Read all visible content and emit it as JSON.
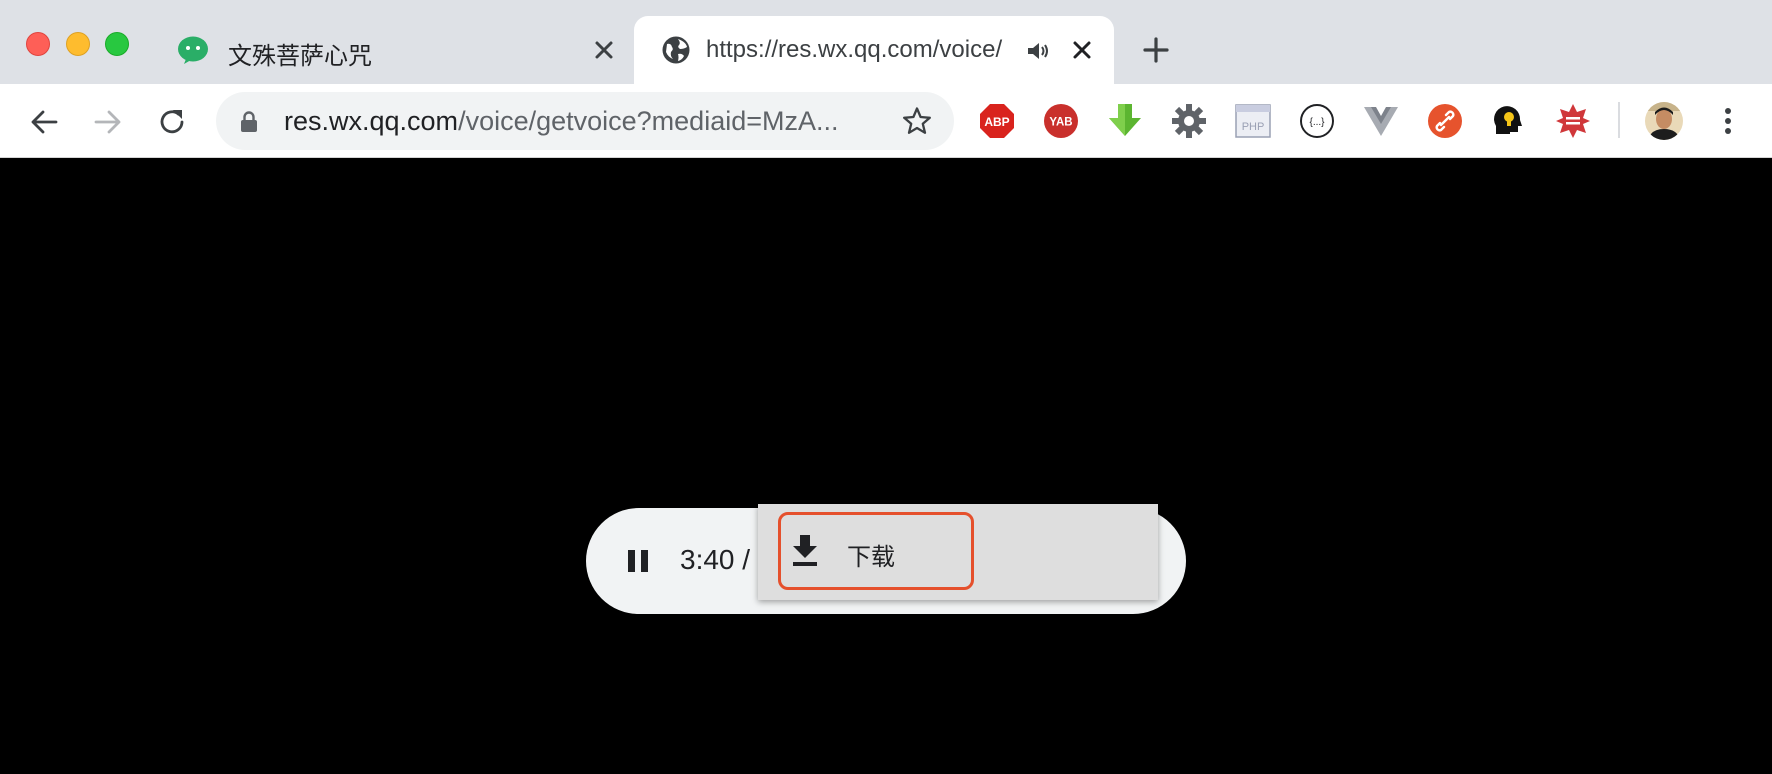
{
  "window": {
    "traffic_lights": [
      "close",
      "minimize",
      "maximize"
    ]
  },
  "tabs": [
    {
      "title": "文殊菩萨心咒",
      "icon": "wechat-icon",
      "active": false
    },
    {
      "title": "https://res.wx.qq.com/voice/",
      "icon": "globe-icon",
      "active": true,
      "audio_icon": "speaker-icon"
    }
  ],
  "toolbar": {
    "url_host": "res.wx.qq.com",
    "url_path": "/voice/getvoice?mediaid=MzA...",
    "extensions": [
      {
        "name": "abp-extension-icon",
        "label": "ABP",
        "color": "#d9231d"
      },
      {
        "name": "yab-extension-icon",
        "label": "YAB",
        "color": "#c9302c"
      },
      {
        "name": "download-arrow-extension-icon",
        "label": "",
        "color": "#5cb531"
      },
      {
        "name": "gear-extension-icon",
        "label": "",
        "color": "#5f6368"
      },
      {
        "name": "php-extension-icon",
        "label": "PHP",
        "color": "#9aa0b4"
      },
      {
        "name": "json-extension-icon",
        "label": "{...}",
        "color": "#202124"
      },
      {
        "name": "vue-extension-icon",
        "label": "",
        "color": "#8a8f98"
      },
      {
        "name": "link-extension-icon",
        "label": "",
        "color": "#e6532d"
      },
      {
        "name": "lightbulb-extension-icon",
        "label": "",
        "color": "#111111"
      },
      {
        "name": "star-badge-extension-icon",
        "label": "",
        "color": "#d0373a"
      }
    ]
  },
  "player": {
    "time": "3:40 /"
  },
  "context_menu": {
    "items": [
      {
        "label": "下载",
        "icon": "download-icon",
        "highlight_color": "#e5502c"
      }
    ]
  }
}
